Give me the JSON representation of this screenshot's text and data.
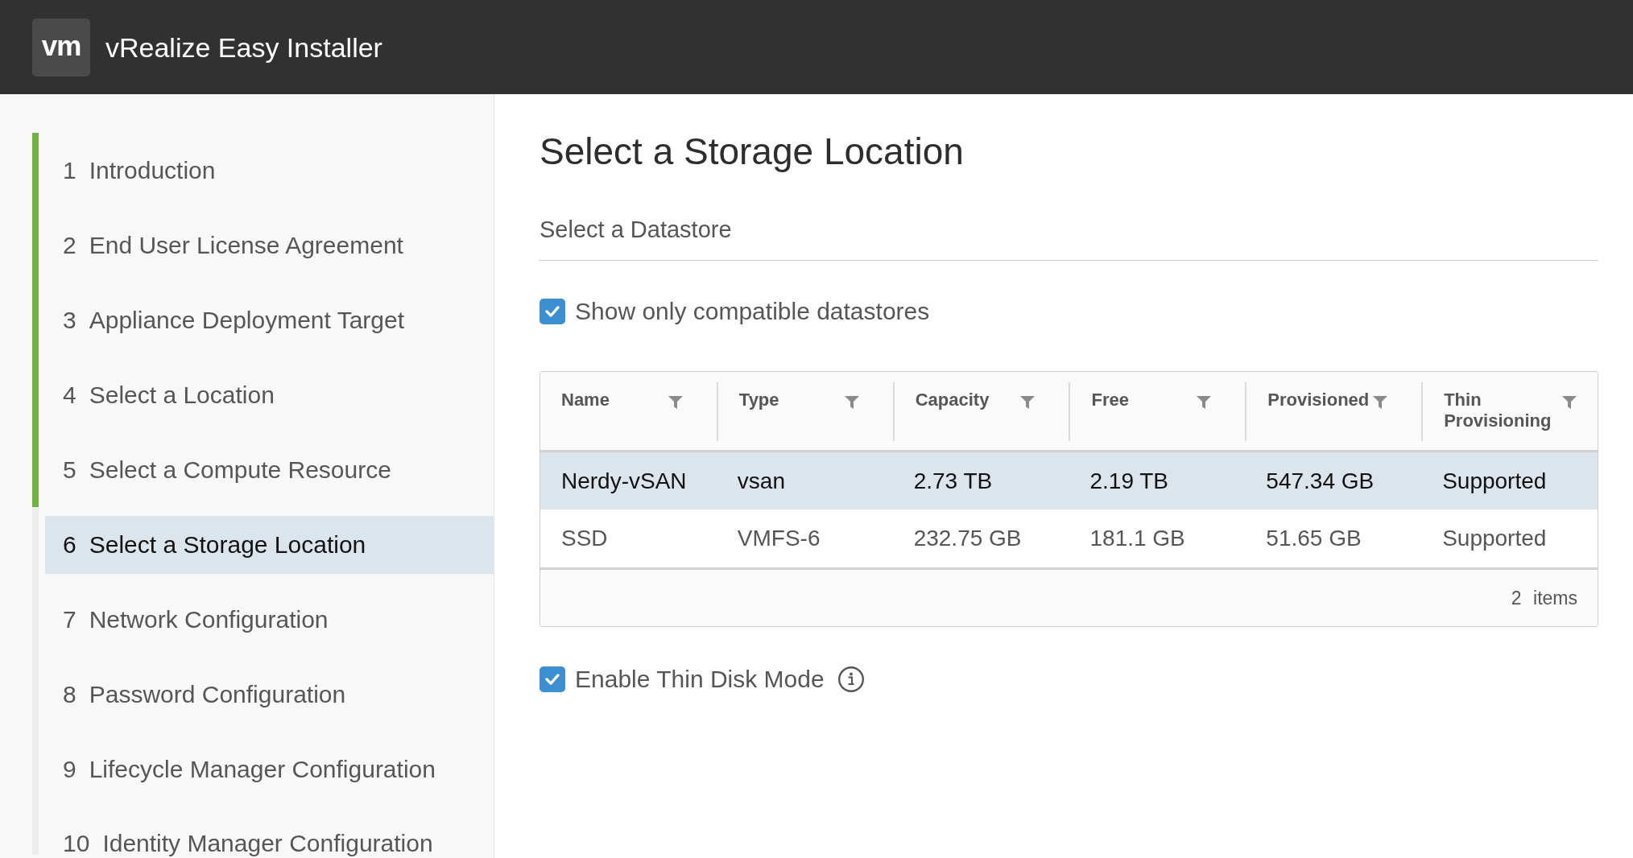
{
  "header": {
    "logo": "vm",
    "title": "vRealize Easy Installer"
  },
  "steps": [
    {
      "number": "1",
      "label": "Introduction",
      "completed": true,
      "selected": false
    },
    {
      "number": "2",
      "label": "End User License Agreement",
      "completed": true,
      "selected": false
    },
    {
      "number": "3",
      "label": "Appliance Deployment Target",
      "completed": true,
      "selected": false
    },
    {
      "number": "4",
      "label": "Select a Location",
      "completed": true,
      "selected": false
    },
    {
      "number": "5",
      "label": "Select a Compute Resource",
      "completed": true,
      "selected": false
    },
    {
      "number": "6",
      "label": "Select a Storage Location",
      "completed": false,
      "selected": true
    },
    {
      "number": "7",
      "label": "Network Configuration",
      "completed": false,
      "selected": false
    },
    {
      "number": "8",
      "label": "Password Configuration",
      "completed": false,
      "selected": false
    },
    {
      "number": "9",
      "label": "Lifecycle Manager Configuration",
      "completed": false,
      "selected": false
    },
    {
      "number": "10",
      "label": "Identity Manager Configuration",
      "completed": false,
      "selected": false
    }
  ],
  "page": {
    "title": "Select a Storage Location",
    "section": "Select a Datastore"
  },
  "compatible_filter": {
    "label": "Show only compatible datastores",
    "checked": true
  },
  "datastores": {
    "columns": [
      "Name",
      "Type",
      "Capacity",
      "Free",
      "Provisioned",
      "Thin Provisioning"
    ],
    "rows": [
      {
        "selected": true,
        "cells": [
          "Nerdy-vSAN",
          "vsan",
          "2.73 TB",
          "2.19 TB",
          "547.34 GB",
          "Supported"
        ]
      },
      {
        "selected": false,
        "cells": [
          "SSD",
          "VMFS-6",
          "232.75 GB",
          "181.1 GB",
          "51.65 GB",
          "Supported"
        ]
      }
    ],
    "footer": "2 items"
  },
  "thin_disk_mode": {
    "label": "Enable Thin Disk Mode",
    "checked": true
  }
}
